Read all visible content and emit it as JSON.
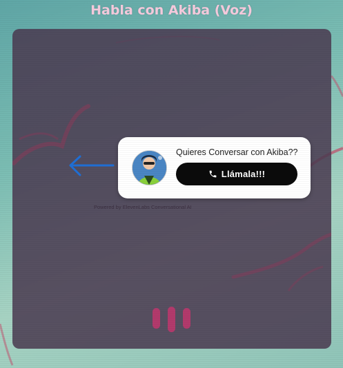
{
  "header": {
    "title": "Habla con Akiba (Voz)"
  },
  "widget": {
    "prompt": "Quieres Conversar con Akiba??",
    "call_button_label": "Llámala!!!",
    "avatar_icon": "akiba-avatar-icon",
    "call_icon": "phone-icon"
  },
  "footer": {
    "powered_by": "Powered by ElevenLabs Conversational AI"
  },
  "colors": {
    "title": "#f3c9db",
    "panel": "#4a3a50",
    "accent_arrow": "#1f6fd6",
    "voice_bars": "#b23a6c",
    "button": "#0b0b0b"
  }
}
